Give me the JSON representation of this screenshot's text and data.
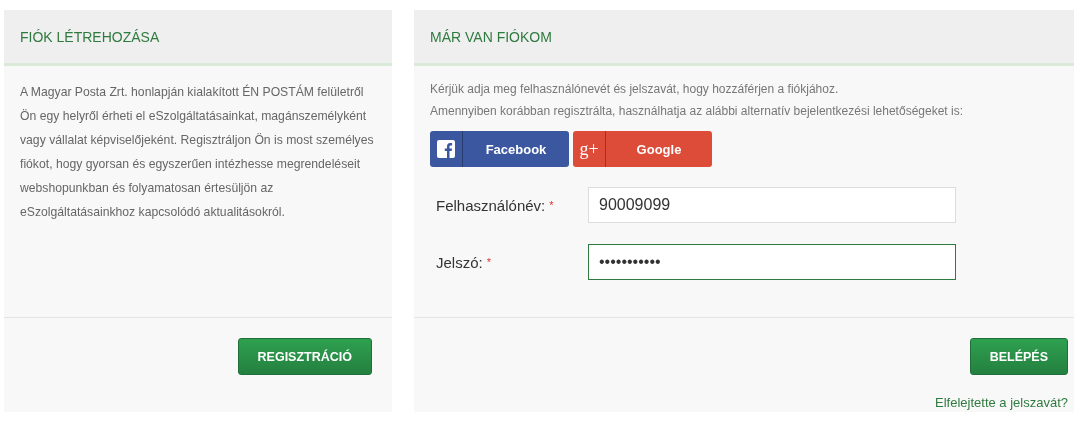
{
  "register_panel": {
    "title": "FIÓK LÉTREHOZÁSA",
    "text": "A Magyar Posta Zrt. honlapján kialakított ÉN POSTÁM felületről Ön egy helyről érheti el eSzolgáltatásainkat, magánszemélyként vagy vállalat képviselőjeként. Regisztráljon Ön is most személyes fiókot, hogy gyorsan és egyszerűen intézhesse megrendeléseit webshopunkban és folyamatosan értesüljön az eSzolgáltatásainkhoz kapcsolódó aktualitásokról.",
    "button": "REGISZTRÁCIÓ"
  },
  "login_panel": {
    "title": "MÁR VAN FIÓKOM",
    "intro": [
      "Kérjük adja meg felhasználónevét és jelszavát, hogy hozzáférjen a fiókjához.",
      "Amennyiben korábban regisztrálta, használhatja az alábbi alternatív bejelentkezési lehetőségeket is:"
    ],
    "social_buttons": [
      {
        "kind": "facebook",
        "label": "Facebook"
      },
      {
        "kind": "google",
        "label": "Google",
        "icon_text": "g+"
      }
    ],
    "fields": [
      {
        "label": "Felhasználónév:",
        "required_mark": "*",
        "value": "90009099",
        "focused": false
      },
      {
        "label": "Jelszó:",
        "required_mark": "*",
        "value": "•••••••••••",
        "focused": true
      }
    ],
    "button": "BELÉPÉS",
    "forgot_link": "Elfelejtette a jelszavát?"
  }
}
